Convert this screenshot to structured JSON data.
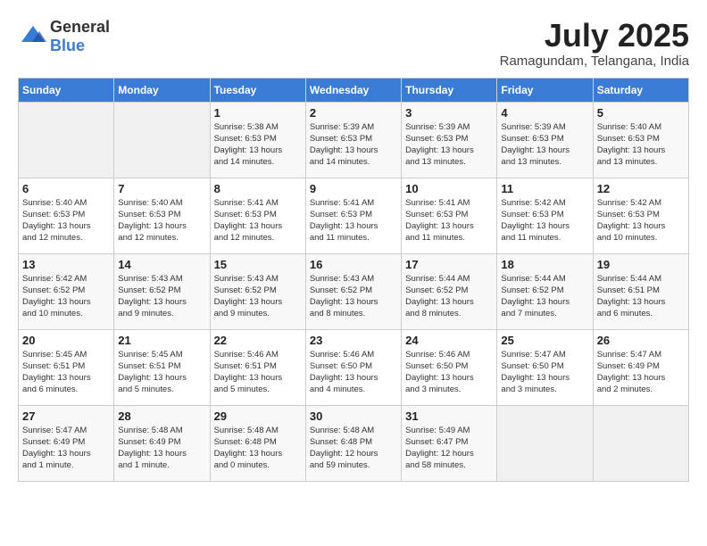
{
  "logo": {
    "general": "General",
    "blue": "Blue"
  },
  "header": {
    "month_year": "July 2025",
    "location": "Ramagundam, Telangana, India"
  },
  "weekdays": [
    "Sunday",
    "Monday",
    "Tuesday",
    "Wednesday",
    "Thursday",
    "Friday",
    "Saturday"
  ],
  "weeks": [
    [
      {
        "day": "",
        "info": ""
      },
      {
        "day": "",
        "info": ""
      },
      {
        "day": "1",
        "info": "Sunrise: 5:38 AM\nSunset: 6:53 PM\nDaylight: 13 hours\nand 14 minutes."
      },
      {
        "day": "2",
        "info": "Sunrise: 5:39 AM\nSunset: 6:53 PM\nDaylight: 13 hours\nand 14 minutes."
      },
      {
        "day": "3",
        "info": "Sunrise: 5:39 AM\nSunset: 6:53 PM\nDaylight: 13 hours\nand 13 minutes."
      },
      {
        "day": "4",
        "info": "Sunrise: 5:39 AM\nSunset: 6:53 PM\nDaylight: 13 hours\nand 13 minutes."
      },
      {
        "day": "5",
        "info": "Sunrise: 5:40 AM\nSunset: 6:53 PM\nDaylight: 13 hours\nand 13 minutes."
      }
    ],
    [
      {
        "day": "6",
        "info": "Sunrise: 5:40 AM\nSunset: 6:53 PM\nDaylight: 13 hours\nand 12 minutes."
      },
      {
        "day": "7",
        "info": "Sunrise: 5:40 AM\nSunset: 6:53 PM\nDaylight: 13 hours\nand 12 minutes."
      },
      {
        "day": "8",
        "info": "Sunrise: 5:41 AM\nSunset: 6:53 PM\nDaylight: 13 hours\nand 12 minutes."
      },
      {
        "day": "9",
        "info": "Sunrise: 5:41 AM\nSunset: 6:53 PM\nDaylight: 13 hours\nand 11 minutes."
      },
      {
        "day": "10",
        "info": "Sunrise: 5:41 AM\nSunset: 6:53 PM\nDaylight: 13 hours\nand 11 minutes."
      },
      {
        "day": "11",
        "info": "Sunrise: 5:42 AM\nSunset: 6:53 PM\nDaylight: 13 hours\nand 11 minutes."
      },
      {
        "day": "12",
        "info": "Sunrise: 5:42 AM\nSunset: 6:53 PM\nDaylight: 13 hours\nand 10 minutes."
      }
    ],
    [
      {
        "day": "13",
        "info": "Sunrise: 5:42 AM\nSunset: 6:52 PM\nDaylight: 13 hours\nand 10 minutes."
      },
      {
        "day": "14",
        "info": "Sunrise: 5:43 AM\nSunset: 6:52 PM\nDaylight: 13 hours\nand 9 minutes."
      },
      {
        "day": "15",
        "info": "Sunrise: 5:43 AM\nSunset: 6:52 PM\nDaylight: 13 hours\nand 9 minutes."
      },
      {
        "day": "16",
        "info": "Sunrise: 5:43 AM\nSunset: 6:52 PM\nDaylight: 13 hours\nand 8 minutes."
      },
      {
        "day": "17",
        "info": "Sunrise: 5:44 AM\nSunset: 6:52 PM\nDaylight: 13 hours\nand 8 minutes."
      },
      {
        "day": "18",
        "info": "Sunrise: 5:44 AM\nSunset: 6:52 PM\nDaylight: 13 hours\nand 7 minutes."
      },
      {
        "day": "19",
        "info": "Sunrise: 5:44 AM\nSunset: 6:51 PM\nDaylight: 13 hours\nand 6 minutes."
      }
    ],
    [
      {
        "day": "20",
        "info": "Sunrise: 5:45 AM\nSunset: 6:51 PM\nDaylight: 13 hours\nand 6 minutes."
      },
      {
        "day": "21",
        "info": "Sunrise: 5:45 AM\nSunset: 6:51 PM\nDaylight: 13 hours\nand 5 minutes."
      },
      {
        "day": "22",
        "info": "Sunrise: 5:46 AM\nSunset: 6:51 PM\nDaylight: 13 hours\nand 5 minutes."
      },
      {
        "day": "23",
        "info": "Sunrise: 5:46 AM\nSunset: 6:50 PM\nDaylight: 13 hours\nand 4 minutes."
      },
      {
        "day": "24",
        "info": "Sunrise: 5:46 AM\nSunset: 6:50 PM\nDaylight: 13 hours\nand 3 minutes."
      },
      {
        "day": "25",
        "info": "Sunrise: 5:47 AM\nSunset: 6:50 PM\nDaylight: 13 hours\nand 3 minutes."
      },
      {
        "day": "26",
        "info": "Sunrise: 5:47 AM\nSunset: 6:49 PM\nDaylight: 13 hours\nand 2 minutes."
      }
    ],
    [
      {
        "day": "27",
        "info": "Sunrise: 5:47 AM\nSunset: 6:49 PM\nDaylight: 13 hours\nand 1 minute."
      },
      {
        "day": "28",
        "info": "Sunrise: 5:48 AM\nSunset: 6:49 PM\nDaylight: 13 hours\nand 1 minute."
      },
      {
        "day": "29",
        "info": "Sunrise: 5:48 AM\nSunset: 6:48 PM\nDaylight: 13 hours\nand 0 minutes."
      },
      {
        "day": "30",
        "info": "Sunrise: 5:48 AM\nSunset: 6:48 PM\nDaylight: 12 hours\nand 59 minutes."
      },
      {
        "day": "31",
        "info": "Sunrise: 5:49 AM\nSunset: 6:47 PM\nDaylight: 12 hours\nand 58 minutes."
      },
      {
        "day": "",
        "info": ""
      },
      {
        "day": "",
        "info": ""
      }
    ]
  ]
}
